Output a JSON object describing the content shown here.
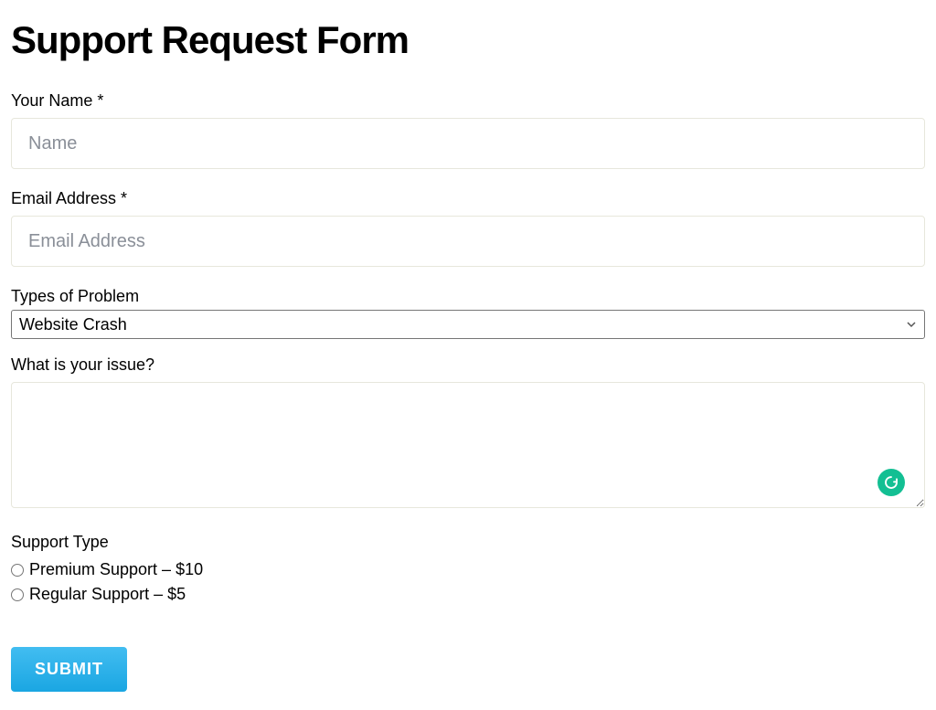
{
  "title": "Support Request Form",
  "fields": {
    "name": {
      "label": "Your Name *",
      "placeholder": "Name"
    },
    "email": {
      "label": "Email Address *",
      "placeholder": "Email Address"
    },
    "problemType": {
      "label": "Types of Problem",
      "selected": "Website Crash"
    },
    "issue": {
      "label": "What is your issue?"
    },
    "supportType": {
      "label": "Support Type",
      "options": [
        {
          "label": "Premium Support  –  $10"
        },
        {
          "label": "Regular Support  –  $5"
        }
      ]
    }
  },
  "submit": {
    "label": "SUBMIT"
  }
}
